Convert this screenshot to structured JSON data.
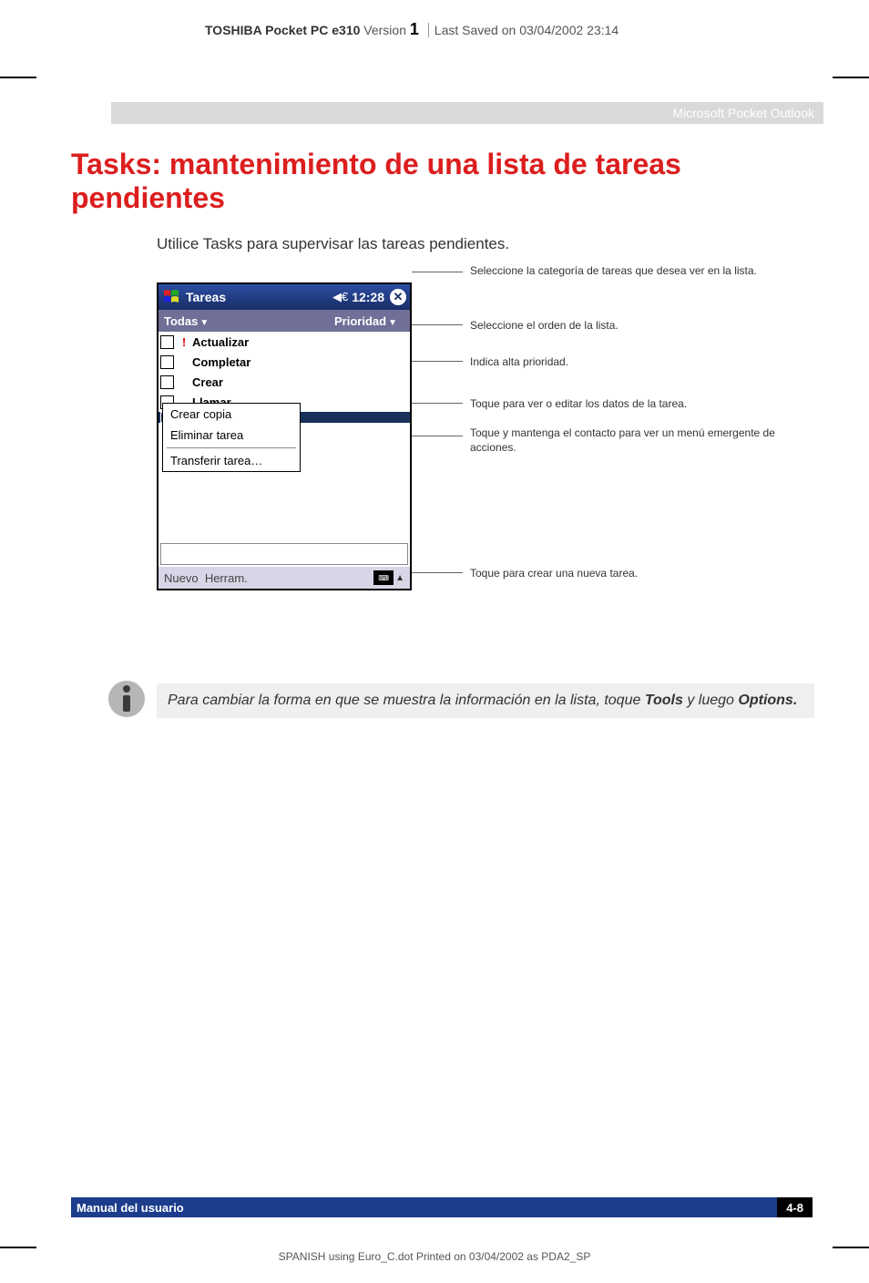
{
  "header": {
    "product": "TOSHIBA Pocket PC e310",
    "version_label": "Version",
    "version_num": "1",
    "saved": "Last Saved on 03/04/2002 23:14"
  },
  "section": "Microsoft Pocket Outlook",
  "title": "Tasks: mantenimiento de una lista de tareas pendientes",
  "intro": "Utilice Tasks para supervisar las tareas pendientes.",
  "pda": {
    "app_title": "Tareas",
    "time": "12:28",
    "filter_left": "Todas",
    "filter_right": "Prioridad",
    "tasks": [
      {
        "label": "Actualizar",
        "high_priority": true,
        "selected": false
      },
      {
        "label": "Completar",
        "high_priority": false,
        "selected": false
      },
      {
        "label": "Crear",
        "high_priority": false,
        "selected": false
      },
      {
        "label": "Llamar",
        "high_priority": false,
        "selected": false
      },
      {
        "label": "",
        "high_priority": false,
        "selected": true
      }
    ],
    "context_menu": {
      "items_top": [
        "Crear copia",
        "Eliminar tarea"
      ],
      "items_bottom": [
        "Transferir tarea…"
      ]
    },
    "bottom_left": "Nuevo",
    "bottom_right": "Herram."
  },
  "callouts": {
    "c1": "Seleccione la categoría de tareas que desea ver en la lista.",
    "c2": "Seleccione el orden de la lista.",
    "c3": "Indica alta prioridad.",
    "c4": "Toque para ver o editar los datos de la tarea.",
    "c5": "Toque y mantenga el contacto para ver un menú emergente de acciones.",
    "c6": "Toque para crear una nueva tarea."
  },
  "tip": {
    "pre": "Para cambiar la forma en que se muestra la información en la lista, toque ",
    "b1": "Tools",
    "mid": " y luego ",
    "b2": "Options."
  },
  "footer": {
    "left": "Manual del usuario",
    "right": "4-8"
  },
  "print_line": "SPANISH using Euro_C.dot   Printed on 03/04/2002 as PDA2_SP"
}
